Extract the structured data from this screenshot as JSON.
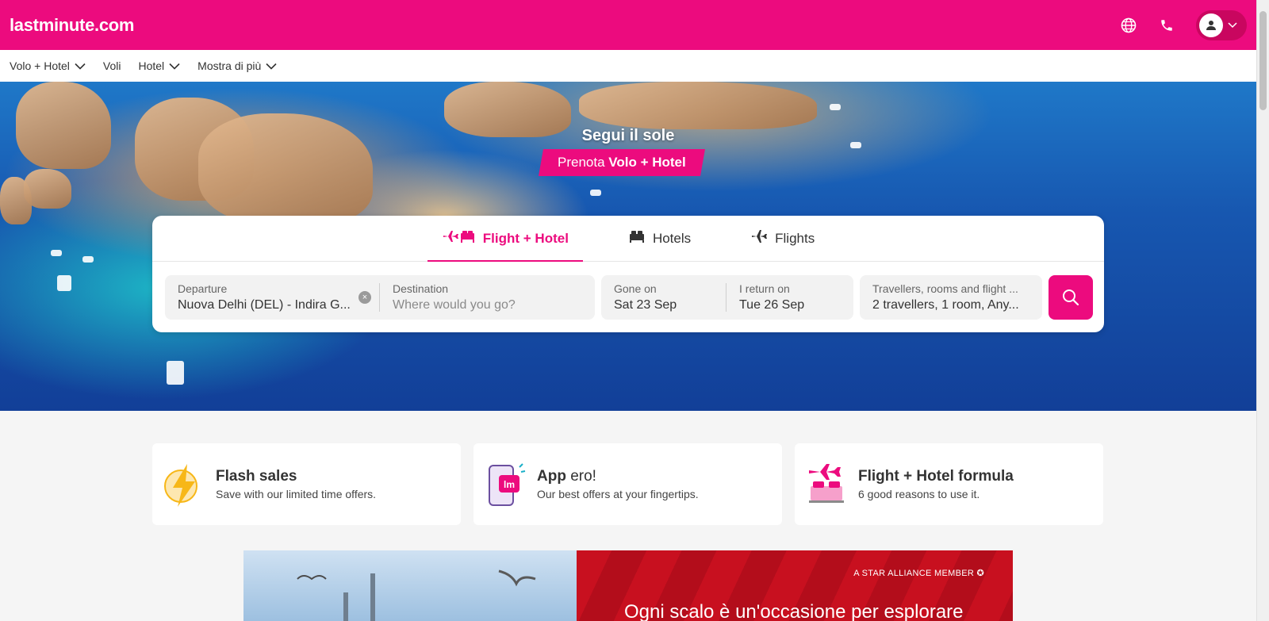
{
  "header": {
    "logo": "lastminute.com",
    "icons": [
      "globe-icon",
      "phone-icon",
      "user-icon",
      "chevron-down-icon"
    ]
  },
  "subnav": {
    "items": [
      {
        "label": "Volo + Hotel",
        "dropdown": true
      },
      {
        "label": "Voli",
        "dropdown": false
      },
      {
        "label": "Hotel",
        "dropdown": true
      },
      {
        "label": "Mostra di più",
        "dropdown": true
      }
    ]
  },
  "hero": {
    "title": "Segui il sole",
    "badge_prefix": "Prenota",
    "badge_bold": "Volo + Hotel"
  },
  "search": {
    "tabs": [
      {
        "label": "Flight + Hotel",
        "active": true
      },
      {
        "label": "Hotels",
        "active": false
      },
      {
        "label": "Flights",
        "active": false
      }
    ],
    "departure": {
      "label": "Departure",
      "value": "Nuova Delhi (DEL) - Indira G..."
    },
    "destination": {
      "label": "Destination",
      "placeholder": "Where would you go?"
    },
    "gone_on": {
      "label": "Gone on",
      "value": "Sat 23 Sep"
    },
    "return_on": {
      "label": "I return on",
      "value": "Tue 26 Sep"
    },
    "travellers": {
      "label": "Travellers, rooms and flight ...",
      "value": "2 travellers, 1 room, Any..."
    }
  },
  "features": [
    {
      "title": "Flash sales",
      "title_light": "",
      "desc": "Save with our limited time offers."
    },
    {
      "title": "App",
      "title_light": "ero!",
      "desc": "Our best offers at your fingertips."
    },
    {
      "title": "Flight + Hotel formula",
      "title_light": "",
      "desc": "6 good reasons to use it."
    }
  ],
  "ad": {
    "tag": "A STAR ALLIANCE MEMBER",
    "headline": "Ogni scalo è un'occasione per esplorare"
  },
  "colors": {
    "brand": "#ec0b7e",
    "brand_dark": "#c9065f",
    "ad_red": "#c8101f"
  }
}
